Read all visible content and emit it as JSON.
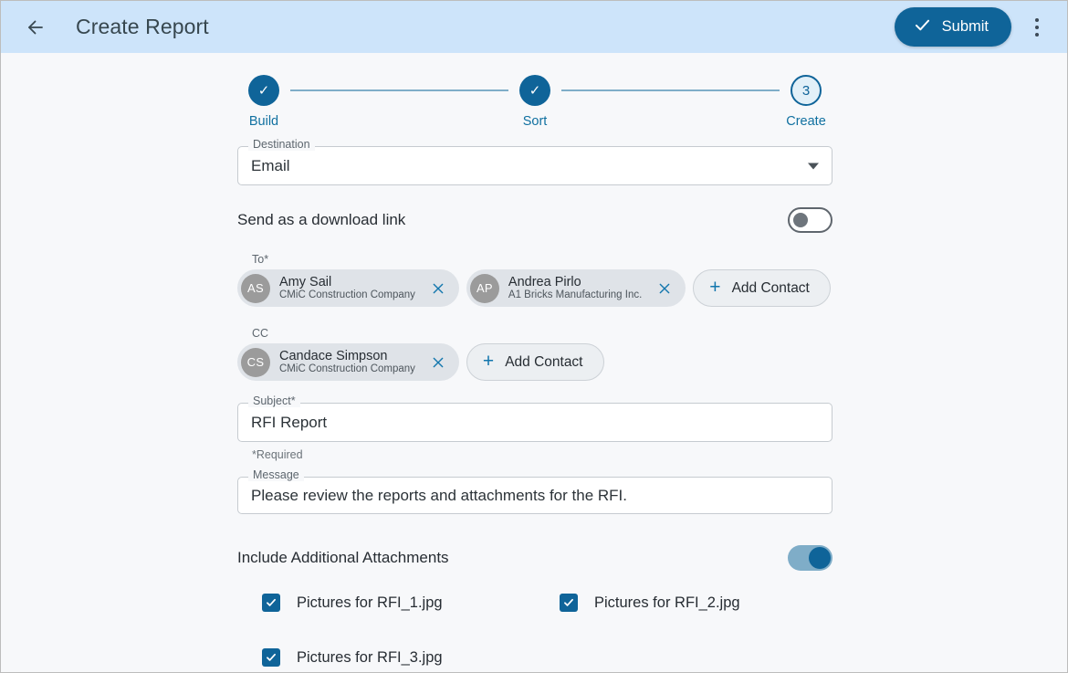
{
  "header": {
    "back_icon": "arrow-left-icon",
    "title": "Create Report",
    "submit_label": "Submit",
    "submit_icon": "check-icon",
    "overflow_icon": "more-vertical-icon",
    "background": "#cde4fa",
    "accent": "#0f6499"
  },
  "stepper": {
    "steps": [
      {
        "label": "Build",
        "marker": "✓",
        "state": "done"
      },
      {
        "label": "Sort",
        "marker": "✓",
        "state": "done"
      },
      {
        "label": "Create",
        "marker": "3",
        "state": "current"
      }
    ]
  },
  "destination": {
    "label": "Destination",
    "value": "Email",
    "caret_icon": "chevron-down-icon"
  },
  "download_link": {
    "label": "Send as a download link",
    "state": "off"
  },
  "to": {
    "label": "To*",
    "contacts": [
      {
        "initials": "AS",
        "name": "Amy Sail",
        "org": "CMiC Construction Company"
      },
      {
        "initials": "AP",
        "name": "Andrea Pirlo",
        "org": "A1 Bricks Manufacturing Inc."
      }
    ],
    "add_label": "Add Contact",
    "add_icon": "plus-icon",
    "remove_icon": "close-icon"
  },
  "cc": {
    "label": "CC",
    "contacts": [
      {
        "initials": "CS",
        "name": "Candace Simpson",
        "org": "CMiC Construction Company"
      }
    ],
    "add_label": "Add Contact",
    "add_icon": "plus-icon",
    "remove_icon": "close-icon"
  },
  "subject": {
    "label": "Subject*",
    "value": "RFI Report",
    "helper": "*Required"
  },
  "message": {
    "label": "Message",
    "value": "Please review the reports and attachments for the RFI."
  },
  "attachments": {
    "label": "Include Additional Attachments",
    "state": "on",
    "files": [
      {
        "name": "Pictures for RFI_1.jpg",
        "checked": true
      },
      {
        "name": "Pictures for RFI_2.jpg",
        "checked": true
      },
      {
        "name": "Pictures for RFI_3.jpg",
        "checked": true
      }
    ]
  }
}
